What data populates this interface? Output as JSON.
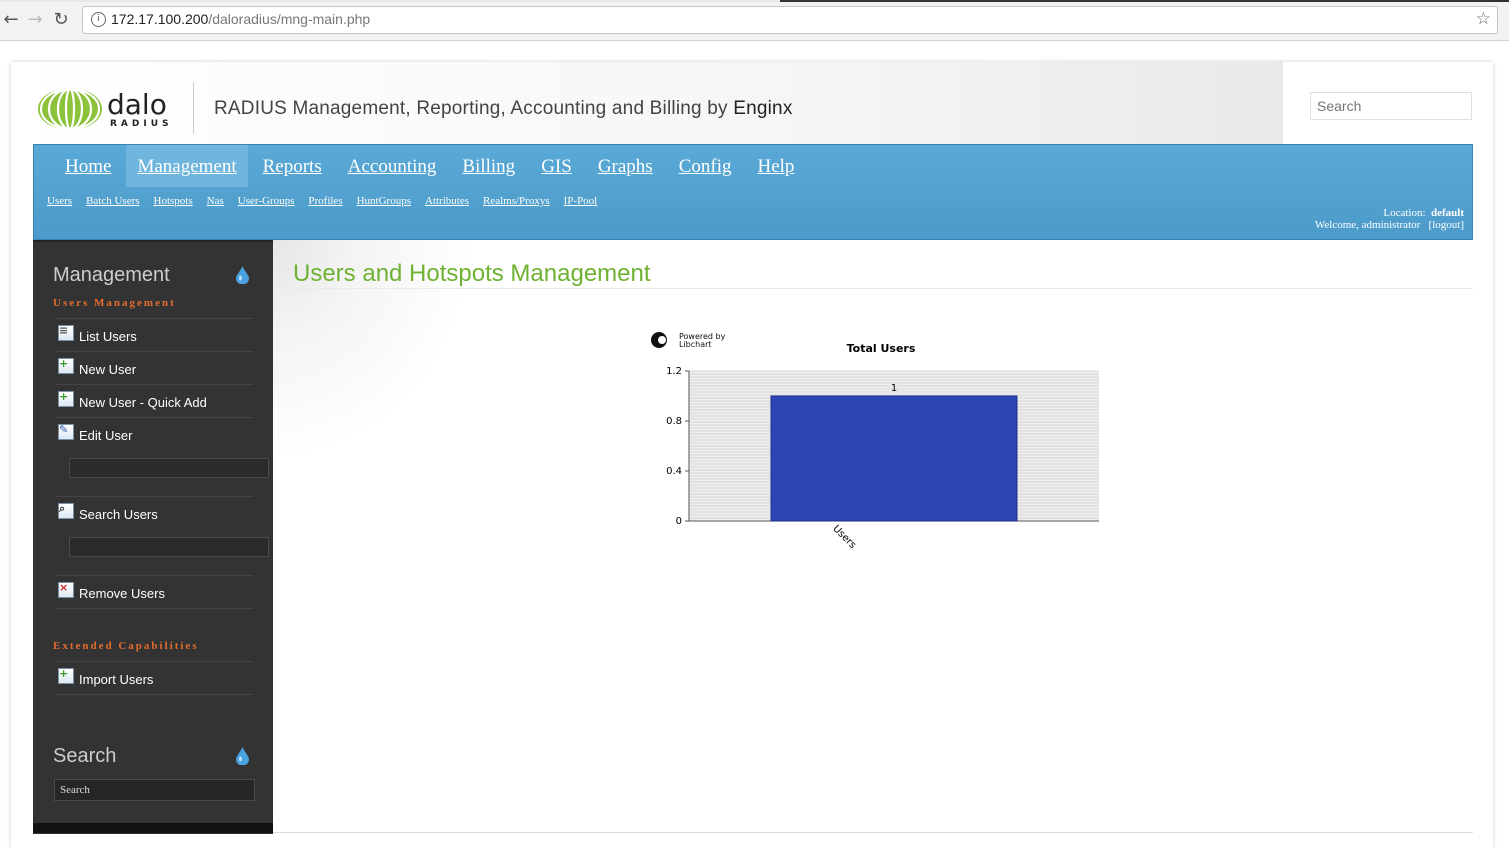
{
  "browser": {
    "url_host": "172.17.100.200",
    "url_path": "/daloradius/mng-main.php"
  },
  "header": {
    "logo_text_main": "dalo",
    "logo_text_sub": "RADIUS",
    "title": "RADIUS Management, Reporting, Accounting and Billing by",
    "title_brand": "Enginx",
    "search_placeholder": "Search"
  },
  "nav": {
    "main": [
      {
        "label": "Home",
        "active": false
      },
      {
        "label": "Management",
        "active": true
      },
      {
        "label": "Reports",
        "active": false
      },
      {
        "label": "Accounting",
        "active": false
      },
      {
        "label": "Billing",
        "active": false
      },
      {
        "label": "GIS",
        "active": false
      },
      {
        "label": "Graphs",
        "active": false
      },
      {
        "label": "Config",
        "active": false
      },
      {
        "label": "Help",
        "active": false
      }
    ],
    "sub": [
      "Users",
      "Batch Users",
      "Hotspots",
      "Nas",
      "User-Groups",
      "Profiles",
      "HuntGroups",
      "Attributes",
      "Realms/Proxys",
      "IP-Pool"
    ],
    "location_label": "Location:",
    "location_value": "default",
    "welcome": "Welcome, administrator",
    "logout": "[logout]"
  },
  "sidebar": {
    "heading": "Management",
    "section_users": "Users Management",
    "items": [
      {
        "label": "List Users",
        "icon": "list-users-icon"
      },
      {
        "label": "New User",
        "icon": "new-user-icon"
      },
      {
        "label": "New User - Quick Add",
        "icon": "quick-add-icon"
      },
      {
        "label": "Edit User",
        "icon": "edit-user-icon"
      },
      {
        "label": "Search Users",
        "icon": "search-users-icon"
      },
      {
        "label": "Remove Users",
        "icon": "remove-users-icon"
      }
    ],
    "section_extended": "Extended Capabilities",
    "import_label": "Import Users",
    "search_heading": "Search",
    "search_value": "Search"
  },
  "content": {
    "title": "Users and Hotspots Management"
  },
  "chart_data": {
    "type": "bar",
    "title": "Total Users",
    "powered_by": "Powered by",
    "powered_name": "Libchart",
    "categories": [
      "Users"
    ],
    "values": [
      1
    ],
    "ylim": [
      0,
      1.2
    ],
    "yticks": [
      "0",
      "0.4",
      "0.8",
      "1.2"
    ],
    "bar_color": "#2c44b4"
  },
  "colors": {
    "accent_green": "#6fb233",
    "nav_blue": "#4c9ac9",
    "section_orange": "#e36c2f"
  }
}
